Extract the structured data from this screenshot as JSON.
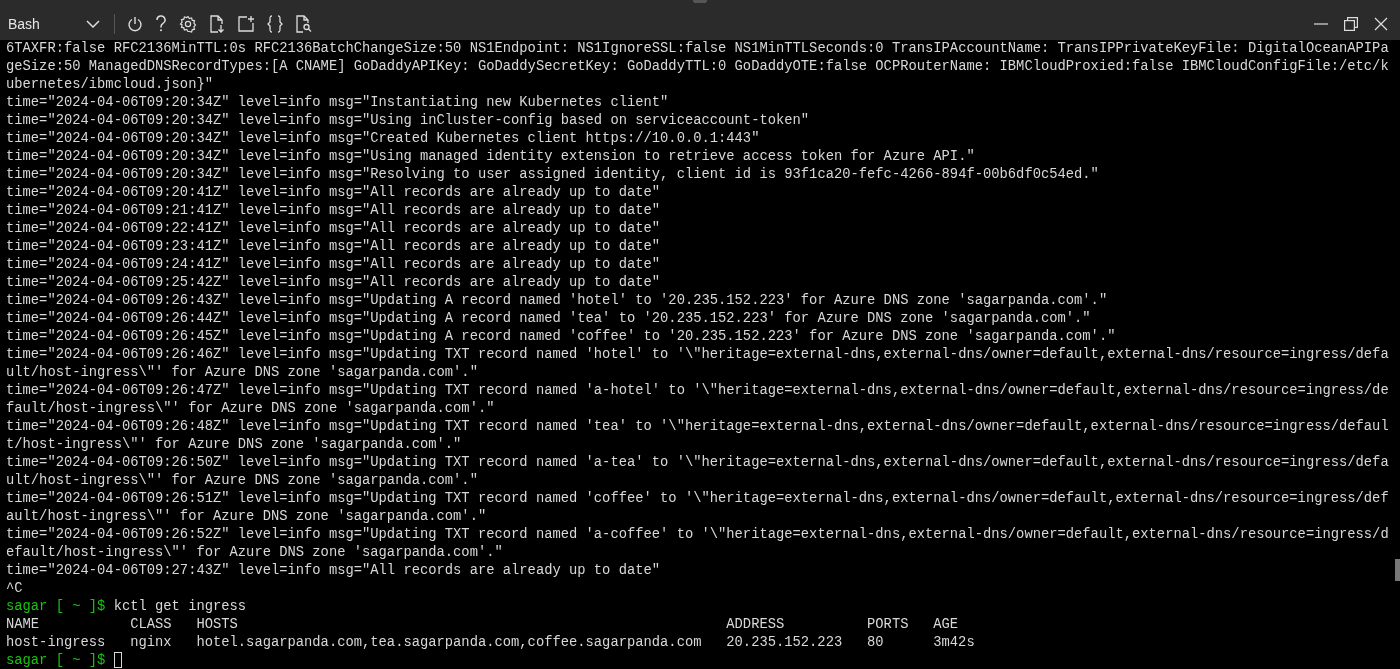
{
  "toolbar": {
    "shell": "Bash"
  },
  "terminal": {
    "lines": [
      {
        "kind": "output",
        "text": "6TAXFR:false RFC2136MinTTL:0s RFC2136BatchChangeSize:50 NS1Endpoint: NS1IgnoreSSL:false NS1MinTTLSeconds:0 TransIPAccountName: TransIPPrivateKeyFile: DigitalOceanAPIPa"
      },
      {
        "kind": "output",
        "text": "geSize:50 ManagedDNSRecordTypes:[A CNAME] GoDaddyAPIKey: GoDaddySecretKey: GoDaddyTTL:0 GoDaddyOTE:false OCPRouterName: IBMCloudProxied:false IBMCloudConfigFile:/etc/k"
      },
      {
        "kind": "output",
        "text": "ubernetes/ibmcloud.json}\""
      },
      {
        "kind": "output",
        "text": "time=\"2024-04-06T09:20:34Z\" level=info msg=\"Instantiating new Kubernetes client\""
      },
      {
        "kind": "output",
        "text": "time=\"2024-04-06T09:20:34Z\" level=info msg=\"Using inCluster-config based on serviceaccount-token\""
      },
      {
        "kind": "output",
        "text": "time=\"2024-04-06T09:20:34Z\" level=info msg=\"Created Kubernetes client https://10.0.0.1:443\""
      },
      {
        "kind": "output",
        "text": "time=\"2024-04-06T09:20:34Z\" level=info msg=\"Using managed identity extension to retrieve access token for Azure API.\""
      },
      {
        "kind": "output",
        "text": "time=\"2024-04-06T09:20:34Z\" level=info msg=\"Resolving to user assigned identity, client id is 93f1ca20-fefc-4266-894f-00b6df0c54ed.\""
      },
      {
        "kind": "output",
        "text": "time=\"2024-04-06T09:20:41Z\" level=info msg=\"All records are already up to date\""
      },
      {
        "kind": "output",
        "text": "time=\"2024-04-06T09:21:41Z\" level=info msg=\"All records are already up to date\""
      },
      {
        "kind": "output",
        "text": "time=\"2024-04-06T09:22:41Z\" level=info msg=\"All records are already up to date\""
      },
      {
        "kind": "output",
        "text": "time=\"2024-04-06T09:23:41Z\" level=info msg=\"All records are already up to date\""
      },
      {
        "kind": "output",
        "text": "time=\"2024-04-06T09:24:41Z\" level=info msg=\"All records are already up to date\""
      },
      {
        "kind": "output",
        "text": "time=\"2024-04-06T09:25:42Z\" level=info msg=\"All records are already up to date\""
      },
      {
        "kind": "output",
        "text": "time=\"2024-04-06T09:26:43Z\" level=info msg=\"Updating A record named 'hotel' to '20.235.152.223' for Azure DNS zone 'sagarpanda.com'.\""
      },
      {
        "kind": "output",
        "text": "time=\"2024-04-06T09:26:44Z\" level=info msg=\"Updating A record named 'tea' to '20.235.152.223' for Azure DNS zone 'sagarpanda.com'.\""
      },
      {
        "kind": "output",
        "text": "time=\"2024-04-06T09:26:45Z\" level=info msg=\"Updating A record named 'coffee' to '20.235.152.223' for Azure DNS zone 'sagarpanda.com'.\""
      },
      {
        "kind": "output",
        "text": "time=\"2024-04-06T09:26:46Z\" level=info msg=\"Updating TXT record named 'hotel' to '\\\"heritage=external-dns,external-dns/owner=default,external-dns/resource=ingress/defa"
      },
      {
        "kind": "output",
        "text": "ult/host-ingress\\\"' for Azure DNS zone 'sagarpanda.com'.\""
      },
      {
        "kind": "output",
        "text": "time=\"2024-04-06T09:26:47Z\" level=info msg=\"Updating TXT record named 'a-hotel' to '\\\"heritage=external-dns,external-dns/owner=default,external-dns/resource=ingress/de"
      },
      {
        "kind": "output",
        "text": "fault/host-ingress\\\"' for Azure DNS zone 'sagarpanda.com'.\""
      },
      {
        "kind": "output",
        "text": "time=\"2024-04-06T09:26:48Z\" level=info msg=\"Updating TXT record named 'tea' to '\\\"heritage=external-dns,external-dns/owner=default,external-dns/resource=ingress/defaul"
      },
      {
        "kind": "output",
        "text": "t/host-ingress\\\"' for Azure DNS zone 'sagarpanda.com'.\""
      },
      {
        "kind": "output",
        "text": "time=\"2024-04-06T09:26:50Z\" level=info msg=\"Updating TXT record named 'a-tea' to '\\\"heritage=external-dns,external-dns/owner=default,external-dns/resource=ingress/defa"
      },
      {
        "kind": "output",
        "text": "ult/host-ingress\\\"' for Azure DNS zone 'sagarpanda.com'.\""
      },
      {
        "kind": "output",
        "text": "time=\"2024-04-06T09:26:51Z\" level=info msg=\"Updating TXT record named 'coffee' to '\\\"heritage=external-dns,external-dns/owner=default,external-dns/resource=ingress/def"
      },
      {
        "kind": "output",
        "text": "ault/host-ingress\\\"' for Azure DNS zone 'sagarpanda.com'.\""
      },
      {
        "kind": "output",
        "text": "time=\"2024-04-06T09:26:52Z\" level=info msg=\"Updating TXT record named 'a-coffee' to '\\\"heritage=external-dns,external-dns/owner=default,external-dns/resource=ingress/d"
      },
      {
        "kind": "output",
        "text": "efault/host-ingress\\\"' for Azure DNS zone 'sagarpanda.com'.\""
      },
      {
        "kind": "output",
        "text": "time=\"2024-04-06T09:27:43Z\" level=info msg=\"All records are already up to date\""
      },
      {
        "kind": "output",
        "text": "^C"
      },
      {
        "kind": "prompt",
        "prompt": "sagar [ ~ ]$",
        "command": "kctl get ingress",
        "cursor": false
      },
      {
        "kind": "table",
        "columns": [
          "NAME",
          "CLASS",
          "HOSTS",
          "ADDRESS",
          "PORTS",
          "AGE"
        ],
        "rows": [
          [
            "host-ingress",
            "nginx",
            "hotel.sagarpanda.com,tea.sagarpanda.com,coffee.sagarpanda.com",
            "20.235.152.223",
            "80",
            "3m42s"
          ]
        ]
      },
      {
        "kind": "prompt",
        "prompt": "sagar [ ~ ]$",
        "cursor": true
      }
    ]
  }
}
